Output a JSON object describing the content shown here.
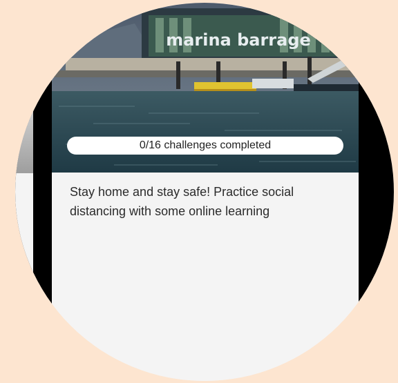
{
  "progress": {
    "label": "0/16 challenges completed"
  },
  "card": {
    "photo_sign": "marina barrage",
    "description": "Stay home and stay safe! Practice social distancing with some online learning"
  },
  "colors": {
    "background": "#fde5d0",
    "card": "#f4f4f4",
    "water": "#2c4a57"
  }
}
